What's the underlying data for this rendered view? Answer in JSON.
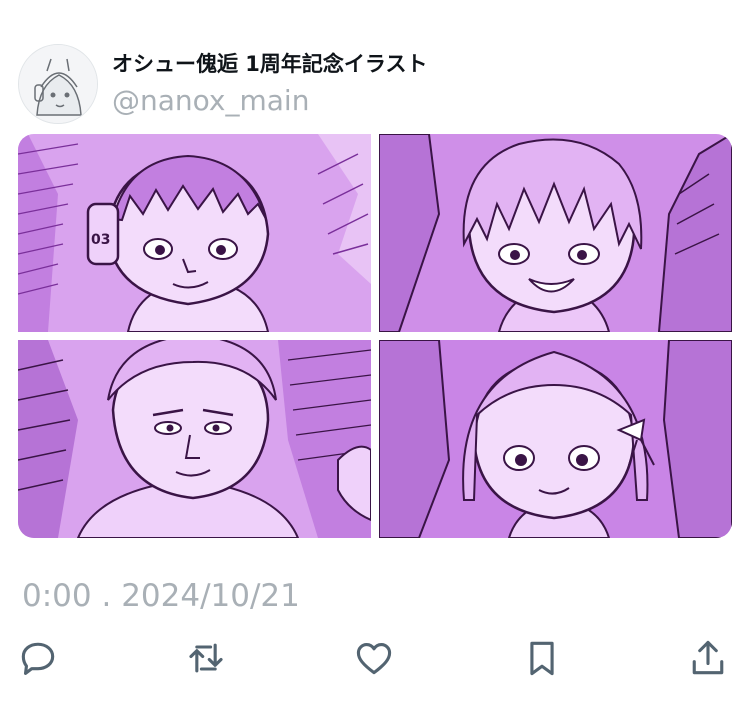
{
  "tweet": {
    "display_name": "オシュー傀逅 1周年記念イラスト",
    "handle": "@nanox_main",
    "time": "0:00",
    "separator": ".",
    "date": "2024/10/21"
  },
  "media": {
    "tint_color": "#c98de6",
    "tiles": [
      "illustration-1",
      "illustration-2",
      "illustration-3",
      "illustration-4"
    ]
  },
  "actions": [
    {
      "name": "reply",
      "icon": "speech-bubble-icon"
    },
    {
      "name": "retweet",
      "icon": "repost-arrows-icon"
    },
    {
      "name": "like",
      "icon": "heart-icon"
    },
    {
      "name": "bookmark",
      "icon": "bookmark-icon"
    },
    {
      "name": "share",
      "icon": "share-upload-icon"
    }
  ],
  "colors": {
    "text_primary": "#0f1419",
    "text_secondary": "#a9b0b6",
    "icon": "#536471"
  }
}
